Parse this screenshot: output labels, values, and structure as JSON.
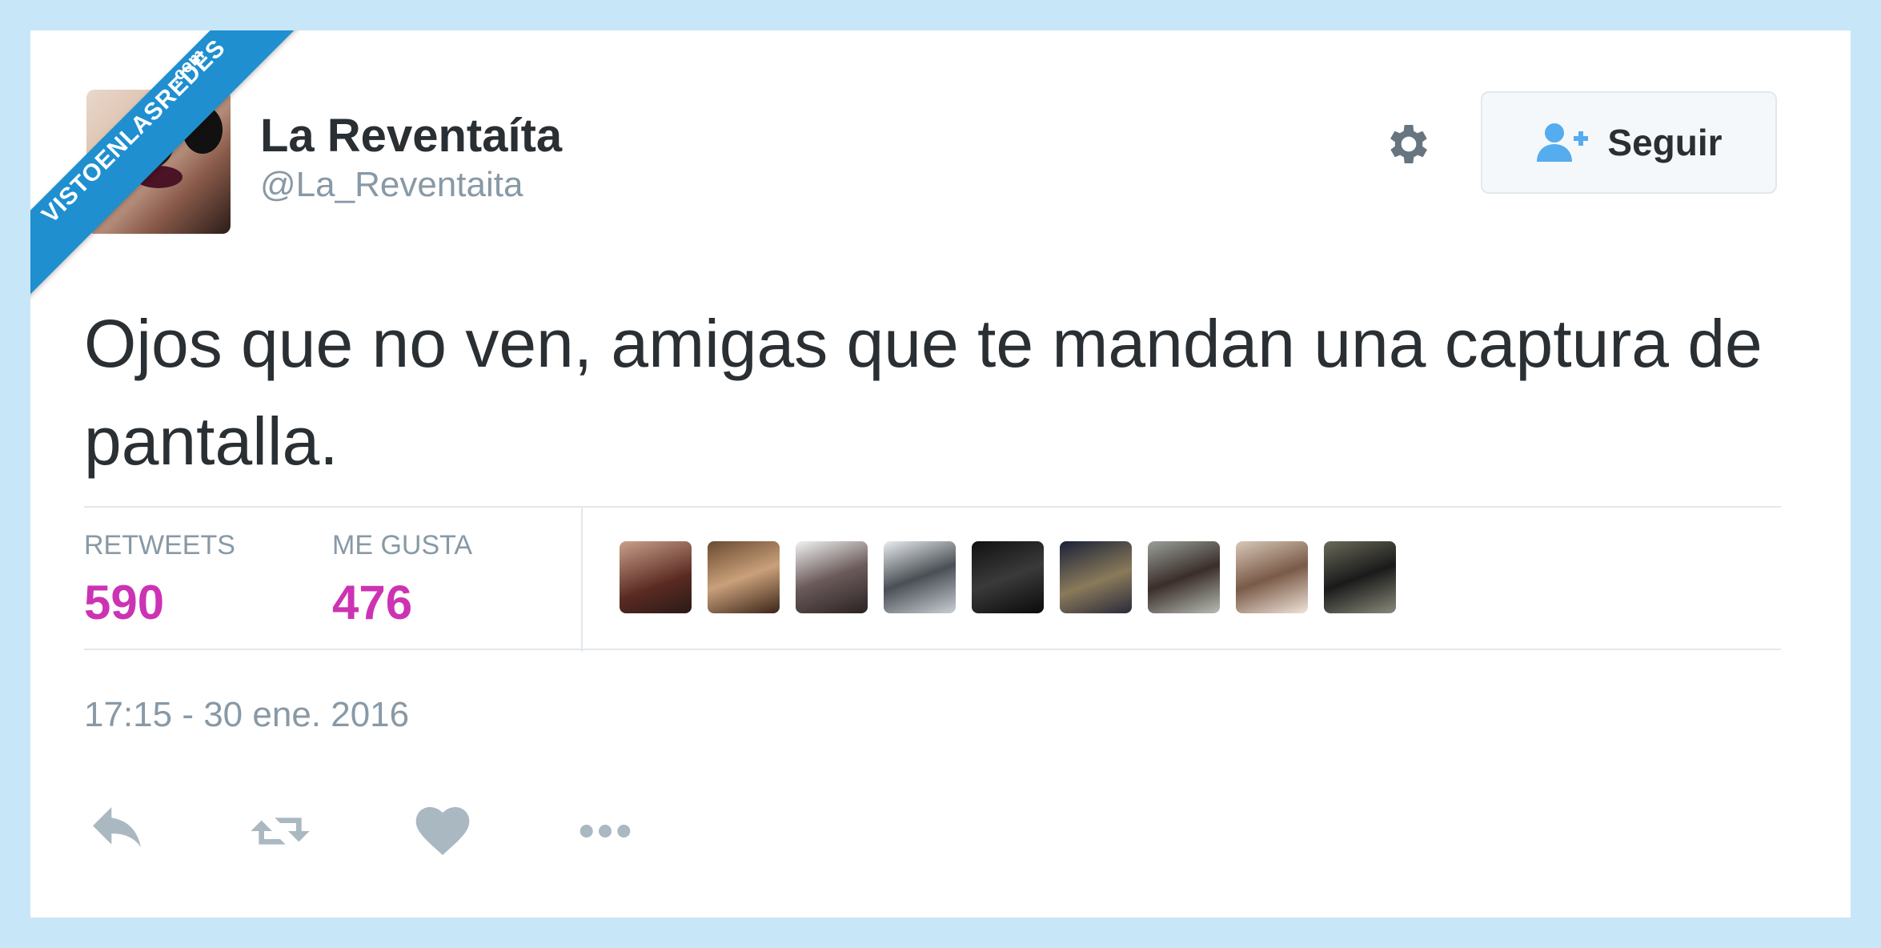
{
  "watermark": {
    "main": "VISTOENLASREDES",
    "sub": ".com"
  },
  "user": {
    "display_name": "La Reventaíta",
    "handle": "@La_Reventaita"
  },
  "follow_button": {
    "label": "Seguir"
  },
  "tweet": {
    "text": "Ojos que no ven, amigas que te mandan una captura de pantalla."
  },
  "stats": {
    "retweets_label": "RETWEETS",
    "retweets_value": "590",
    "likes_label": "ME GUSTA",
    "likes_value": "476"
  },
  "timestamp": "17:15 - 30 ene. 2016",
  "colors": {
    "accent": "#cc33b3",
    "muted": "#8899a6",
    "text": "#292f33",
    "background": "#c7e6f7",
    "ribbon": "#1f8fd0"
  },
  "icons": {
    "gear": "gear-icon",
    "follow": "user-plus-icon",
    "reply": "reply-icon",
    "retweet": "retweet-icon",
    "like": "heart-icon",
    "more": "more-dots-icon"
  }
}
